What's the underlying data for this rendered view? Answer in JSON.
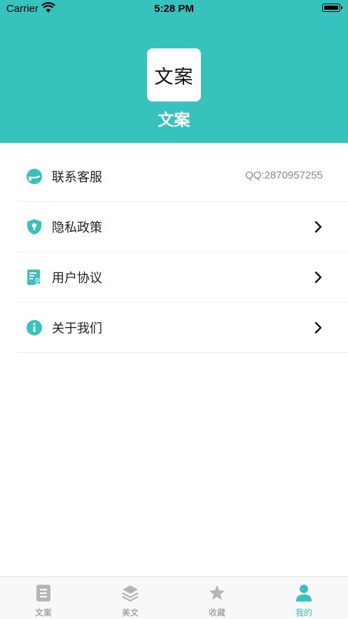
{
  "status_bar": {
    "carrier": "Carrier",
    "time": "5:28 PM"
  },
  "header": {
    "logo_text": "文案",
    "app_name": "文案",
    "background_color": "#38c2bd"
  },
  "menu": [
    {
      "label": "联系客服",
      "value": "QQ:2870957255",
      "icon": "customer-service-icon"
    },
    {
      "label": "隐私政策",
      "icon": "shield-lock-icon",
      "chevron": true
    },
    {
      "label": "用户协议",
      "icon": "document-user-icon",
      "chevron": true
    },
    {
      "label": "关于我们",
      "icon": "info-icon",
      "chevron": true
    }
  ],
  "tabbar": {
    "tabs": [
      {
        "label": "文案",
        "icon": "document-icon",
        "active": false
      },
      {
        "label": "美文",
        "icon": "layers-icon",
        "active": false
      },
      {
        "label": "收藏",
        "icon": "star-icon",
        "active": false
      },
      {
        "label": "我的",
        "icon": "person-icon",
        "active": true
      }
    ],
    "active_color": "#38c2bd",
    "inactive_color": "#b5b5b5"
  }
}
